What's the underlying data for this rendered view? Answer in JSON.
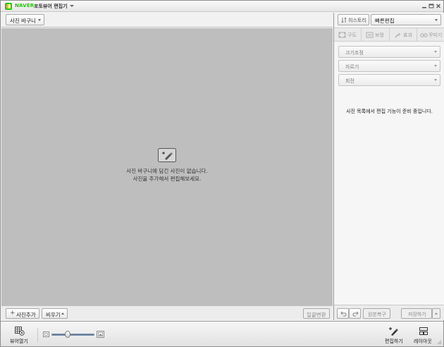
{
  "window": {
    "brand": "NAVER",
    "title": "포토뷰어 편집기"
  },
  "left": {
    "basket_dropdown": "사진 바구니",
    "empty_line1": "사진 바구니에 담긴 사진이 없습니다.",
    "empty_line2": "사진을 추가해서 편집해보세요.",
    "add_button": "사진추가",
    "clear_button": "비우기",
    "batch_button": "일괄변환"
  },
  "right": {
    "history_button": "히스토리",
    "quick_edit_dropdown": "빠른편집",
    "tabs": [
      "구도",
      "보정",
      "효과",
      "꾸미기"
    ],
    "sections": [
      "크기조정",
      "자르기",
      "회전"
    ],
    "message": "사진 목록에서 편집 기능이 준비 중입니다.",
    "restore_button": "원본복구",
    "save_button": "저장하기"
  },
  "bottom": {
    "viewer_open": "뷰어열기",
    "zoom_level": 0.35,
    "edit_tool": "편집하기",
    "layout_tool": "레이아웃"
  },
  "colors": {
    "brand_green": "#1ec800",
    "canvas_gray": "#bebebe",
    "slider_blue": "#5f7fa0"
  },
  "icons": [
    "naver-logo-icon",
    "minimize-icon",
    "maximize-icon",
    "close-icon",
    "add-photo-icon",
    "history-icon",
    "composition-icon",
    "correction-icon",
    "effect-icon",
    "decorate-icon",
    "undo-icon",
    "redo-icon",
    "viewer-icon",
    "zoom-out-icon",
    "zoom-in-icon",
    "edit-icon",
    "layout-icon"
  ]
}
